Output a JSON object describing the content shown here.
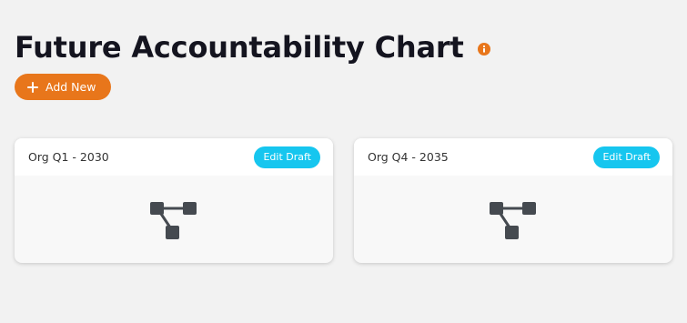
{
  "page": {
    "title": "Future Accountability Chart",
    "info_icon": "info-icon"
  },
  "actions": {
    "add_new_label": "Add New",
    "add_icon": "plus-icon"
  },
  "colors": {
    "accent": "#e8761b",
    "edit_button": "#16c6ef",
    "title": "#14141f",
    "background": "#f2f2f2",
    "icon": "#454a50"
  },
  "cards": [
    {
      "title": "Org Q1 - 2030",
      "edit_label": "Edit Draft",
      "icon": "org-chart-icon"
    },
    {
      "title": "Org Q4 - 2035",
      "edit_label": "Edit Draft",
      "icon": "org-chart-icon"
    }
  ]
}
